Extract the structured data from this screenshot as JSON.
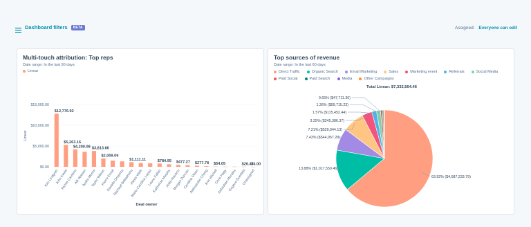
{
  "header": {
    "filters_label": "Dashboard filters",
    "beta_badge": "BETA",
    "assigned_label": "Assigned:",
    "assigned_value": "Everyone can edit"
  },
  "card1": {
    "title": "Multi-touch attribution: Top reps",
    "date_range": "Date range: In the last 90 days",
    "legend": "Linear"
  },
  "card2": {
    "title": "Top sources of revenue",
    "date_range": "Date range: In the last 60 days",
    "total": "Total Linear: $7,332,564.46"
  },
  "colors": {
    "bar": "#ff9e80",
    "link": "#0091ae",
    "beta": "#6a78d1"
  },
  "chart_data": [
    {
      "type": "bar",
      "xlabel": "Deal owner",
      "ylabel": "Linear",
      "ylim": [
        0,
        15000
      ],
      "yticks": [
        "$0.00",
        "$5,000.00",
        "$10,000.00",
        "$15,000.00"
      ],
      "grid": true,
      "legend": "top-left",
      "categories": [
        "Kim Lindgren",
        "John Keele",
        "Richie Cardone",
        "Alli Watson",
        "Audra Moore",
        "Taylor Wilson",
        "Pierre Ecroil",
        "Daniela Oropeza",
        "Rachael Belladonna",
        "Alexis Wals",
        "Maria Carolina Lopez",
        "Laura Fallon",
        "Katherine Murphy",
        "Anita Navarro",
        "Morgan Duncan",
        "Carolina Olsen",
        "Aleksander Cheng",
        "Kris Wichell",
        "Chris Hagy",
        "Sebastian Morales",
        "Eugene Domfeld",
        "Unassigned"
      ],
      "values": [
        12776.92,
        5263.16,
        4200.08,
        3600,
        3813.66,
        2009.09,
        1500,
        1300,
        1111.11,
        900,
        850,
        784.95,
        600,
        477.27,
        400,
        277.78,
        150,
        54.05,
        45,
        35,
        26.47,
        4.0
      ],
      "data_labels": [
        {
          "index": 0,
          "text": "$12,776.92"
        },
        {
          "index": 1,
          "text": "$5,263.16"
        },
        {
          "index": 2,
          "text": "$4,200.08"
        },
        {
          "index": 4,
          "text": "$3,813.66"
        },
        {
          "index": 5,
          "text": "$2,009.09"
        },
        {
          "index": 8,
          "text": "$1,111.11"
        },
        {
          "index": 11,
          "text": "$784.95"
        },
        {
          "index": 13,
          "text": "$477.27"
        },
        {
          "index": 15,
          "text": "$277.78"
        },
        {
          "index": 17,
          "text": "$54.05"
        },
        {
          "index": 20,
          "text": "$26.47"
        },
        {
          "index": 21,
          "text": "$4.00"
        }
      ]
    },
    {
      "type": "pie",
      "legend": "top-left",
      "slices": [
        {
          "name": "Direct Traffic",
          "percent": 63.92,
          "value": 4687233.79,
          "color": "#ff9e80",
          "label": "63.92% ($4,687,233.79)"
        },
        {
          "name": "Organic Search",
          "percent": 13.88,
          "value": 1017550.46,
          "color": "#00bda5",
          "label": "13.88% ($1,017,550.46)"
        },
        {
          "name": "Email Marketing",
          "percent": 7.43,
          "value": 544957.28,
          "color": "#a28ae5",
          "label": "7.43% ($544,957.28)"
        },
        {
          "name": "Sales",
          "percent": 7.21,
          "value": 529044.13,
          "color": "#ffc683",
          "label": "7.21% ($529,044.13)"
        },
        {
          "name": "Marketing event",
          "percent": 3.35,
          "value": 245386.37,
          "color": "#f2547d",
          "label": "3.35% ($245,386.37)"
        },
        {
          "name": "Referrals",
          "percent": 1.57,
          "value": 115452.44,
          "color": "#4fb3e6",
          "label": "1.57% ($115,452.44)"
        },
        {
          "name": "Social Media",
          "percent": 1.36,
          "value": 99715.23,
          "color": "#7fd1ae",
          "label": "1.36% ($99,715.23)"
        },
        {
          "name": "Paid Social",
          "percent": 0.65,
          "value": 47711.36,
          "color": "#e85d4d",
          "label": "0.65% ($47,711.36)"
        },
        {
          "name": "Paid Search",
          "percent": 0.35,
          "value": 25800,
          "color": "#008276",
          "label": ""
        },
        {
          "name": "Media",
          "percent": 0.15,
          "value": 10900,
          "color": "#8a5fe8",
          "label": ""
        },
        {
          "name": "Other Campaigns",
          "percent": 0.13,
          "value": 9500,
          "color": "#ff8a2e",
          "label": ""
        }
      ]
    }
  ]
}
